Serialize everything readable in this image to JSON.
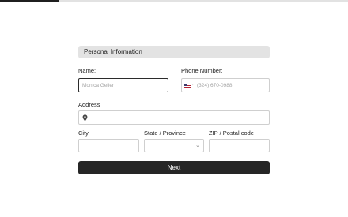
{
  "progress": {
    "fraction": 0.17
  },
  "section": {
    "title": "Personal Information"
  },
  "name": {
    "label": "Name:",
    "placeholder": "Monica Geller"
  },
  "phone": {
    "label": "Phone Number:",
    "placeholder": "(324) 670-0988",
    "country_icon": "us-flag-icon"
  },
  "address": {
    "label": "Address",
    "icon": "map-pin-icon"
  },
  "city": {
    "label": "City"
  },
  "state": {
    "label": "State / Province",
    "icon": "chevron-down-icon"
  },
  "zip": {
    "label": "ZIP / Postal code"
  },
  "next": {
    "label": "Next"
  },
  "colors": {
    "accent": "#262626",
    "header_bg": "#e3e3e3",
    "border": "#cfcfcf"
  }
}
